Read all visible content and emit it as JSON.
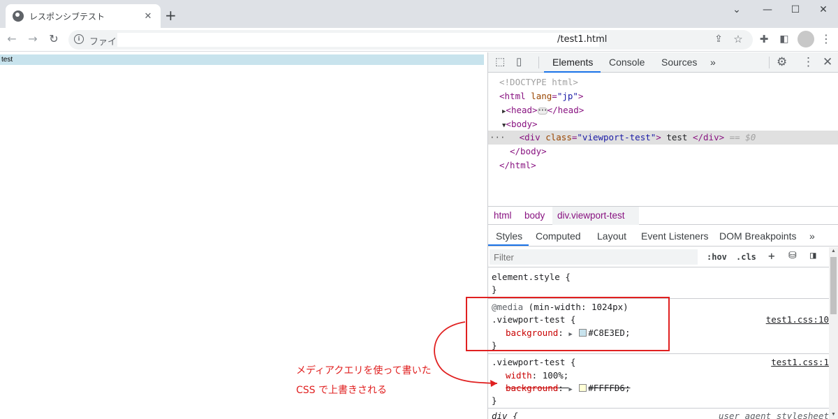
{
  "browser": {
    "tab_title": "レスポンシブテスト",
    "tab_close": "✕",
    "new_tab": "+",
    "win_minimize": "⌄",
    "win_min": "—",
    "win_max": "☐",
    "win_close": "✕",
    "omnibox_label": "ファイル",
    "omnibox_url": "/test1.html"
  },
  "viewport": {
    "text": "test",
    "background": "#C8E3ED"
  },
  "devtools": {
    "tabs": [
      "Elements",
      "Console",
      "Sources",
      "»"
    ],
    "dom": {
      "doctype": "<!DOCTYPE html>",
      "html_open_tag": "<html",
      "html_attr": "lang",
      "html_attr_val": "\"jp\"",
      "head": "<head>",
      "head_close": "</head>",
      "body": "<body>",
      "div_open": "<div",
      "div_attr": "class",
      "div_attr_val": "\"viewport-test\"",
      "div_text": " test ",
      "div_close": "</div>",
      "div_suffix": "== $0",
      "body_close": "</body>",
      "html_close": "</html>",
      "dots": "···"
    },
    "breadcrumbs": [
      "html",
      "body",
      "div.viewport-test"
    ],
    "subtabs": [
      "Styles",
      "Computed",
      "Layout",
      "Event Listeners",
      "DOM Breakpoints",
      "»"
    ],
    "filter_placeholder": "Filter",
    "hov": ":hov",
    "cls": ".cls",
    "styles": {
      "element_style": "element.style {",
      "close_brace": "}",
      "media_at": "@media",
      "media_query": " (min-width: 1024px)",
      "selector": ".viewport-test {",
      "prop_background": "background",
      "prop_width": "width",
      "val_width": "100%;",
      "val_bg1": "#C8E3ED;",
      "val_bg2": "#FFFFD6;",
      "src1": "test1.css:10",
      "src2": "test1.css:1",
      "div_selector": "div {",
      "ua": "user agent stylesheet"
    },
    "colors": {
      "swatch1": "#C8E3ED",
      "swatch2": "#FFFFD6"
    }
  },
  "annotation": {
    "line1": "メディアクエリを使って書いた",
    "line2": "CSS で上書きされる",
    "color": "#e02020"
  }
}
